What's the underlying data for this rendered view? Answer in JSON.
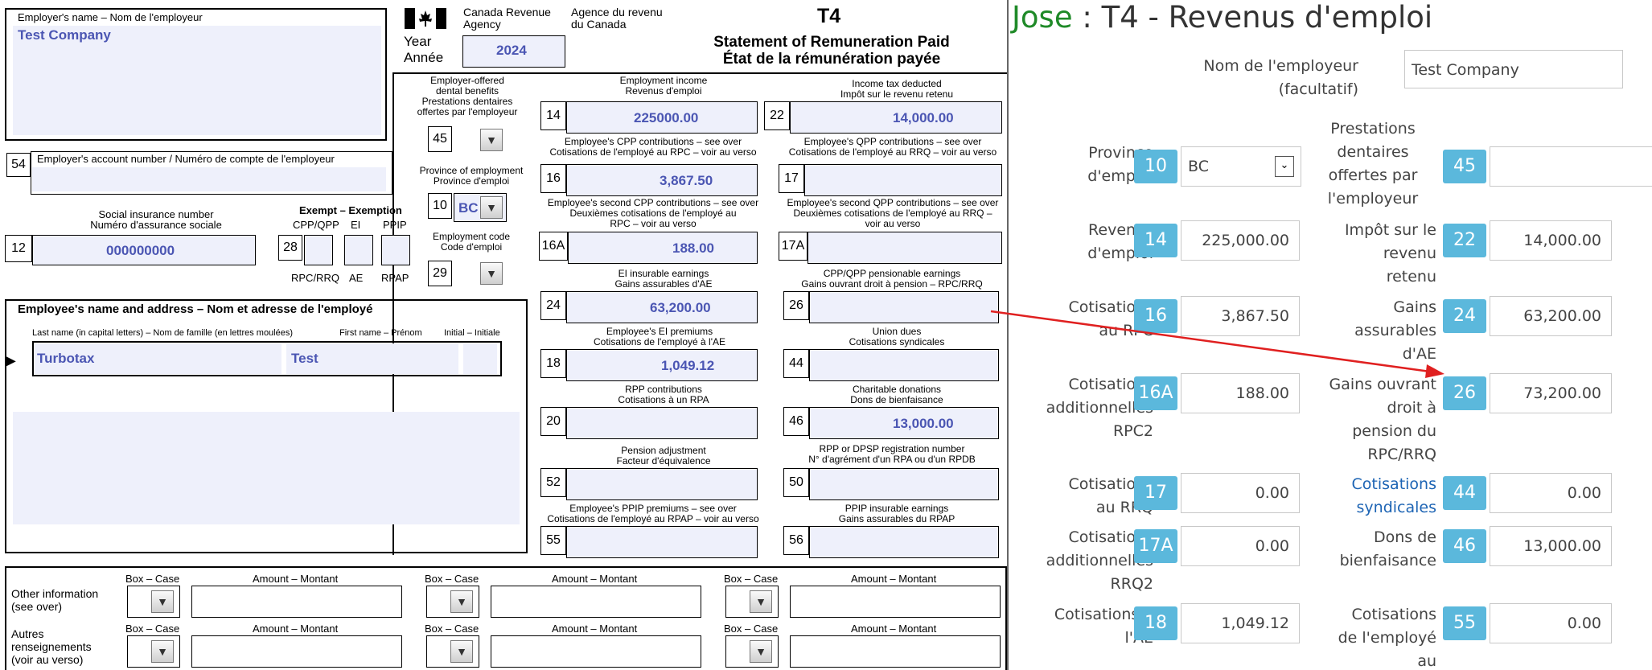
{
  "form": {
    "employer_name_label": "Employer's name – Nom de l'employeur",
    "employer_name_value": "Test Company",
    "cra_en": "Canada Revenue\nAgency",
    "cra_fr": "Agence du revenu\ndu Canada",
    "year_label": "Year\nAnnée",
    "year_value": "2024",
    "t4": "T4",
    "statement_en": "Statement of Remuneration Paid",
    "statement_fr": "État de la rémunération payée",
    "dental_label": "Employer-offered\ndental benefits\nPrestations dentaires\noffertes par l'employeur",
    "box45": "45",
    "employment_income_label": "Employment income\nRevenus d'emploi",
    "box14": "14",
    "box14_value": "225000.00",
    "tax_deducted_label": "Income tax deducted\nImpôt sur le revenu retenu",
    "box22": "22",
    "box22_value": "14,000.00",
    "account_label": "Employer's account number / Numéro de compte de l'employeur",
    "box54": "54",
    "cpp_label": "Employee's CPP contributions – see over\nCotisations de l'employé au RPC – voir au verso",
    "box16": "16",
    "box16_value": "3,867.50",
    "qpp_label": "Employee's QPP contributions – see over\nCotisations de l'employé au RRQ – voir au verso",
    "box17": "17",
    "province_label": "Province of employment\nProvince d'emploi",
    "box10": "10",
    "box10_value": "BC",
    "sin_label": "Social insurance number\nNuméro d'assurance sociale",
    "box12": "12",
    "sin_value": "000000000",
    "exempt_label": "Exempt – Exemption",
    "cpp_qpp": "CPP/QPP",
    "ei": "EI",
    "ppip": "PPIP",
    "box28": "28",
    "rpc_rrq": "RPC/RRQ",
    "ae": "AE",
    "rpap": "RPAP",
    "cpp2_label": "Employee's second CPP contributions – see over\nDeuxièmes cotisations de l'employé au\nRPC – voir au verso",
    "box16a": "16A",
    "box16a_value": "188.00",
    "qpp2_label": "Employee's second QPP contributions – see over\nDeuxièmes cotisations de l'employé au RRQ –\nvoir au verso",
    "box17a": "17A",
    "emp_code_label": "Employment code\nCode d'emploi",
    "box29": "29",
    "ei_earn_label": "EI insurable earnings\nGains assurables d'AE",
    "box24": "24",
    "box24_value": "63,200.00",
    "pens_earn_label": "CPP/QPP pensionable earnings\nGains ouvrant droit à pension – RPC/RRQ",
    "box26": "26",
    "emp_name_label": "Employee's name and address – Nom et adresse de l'employé",
    "last_name_label": "Last name (in capital letters) – Nom de famille (en lettres moulées)",
    "first_name_label": "First name – Prénom",
    "initial_label": "Initial – Initiale",
    "last_name_value": "Turbotax",
    "first_name_value": "Test",
    "ei_prem_label": "Employee's EI premiums\nCotisations de l'employé à l'AE",
    "box18": "18",
    "box18_value": "1,049.12",
    "union_label": "Union dues\nCotisations syndicales",
    "box44": "44",
    "rpp_label": "RPP contributions\nCotisations à un RPA",
    "box20": "20",
    "charity_label": "Charitable donations\nDons de bienfaisance",
    "box46": "46",
    "box46_value": "13,000.00",
    "pension_adj_label": "Pension adjustment\nFacteur d'équivalence",
    "box52": "52",
    "rpp_reg_label": "RPP or DPSP registration number\nN° d'agrément d'un RPA ou d'un RPDB",
    "box50": "50",
    "ppip_prem_label": "Employee's PPIP premiums – see over\nCotisations de l'employé au RPAP – voir au verso",
    "box55": "55",
    "ppip_earn_label": "PPIP insurable earnings\nGains assurables du RPAP",
    "box56": "56",
    "other_info_en": "Other information\n(see over)",
    "other_info_fr": "Autres\nrenseignements\n(voir au verso)",
    "box_case": "Box – Case",
    "amount_montant": "Amount – Montant"
  },
  "panel": {
    "who": "Jose",
    "sep": " : ",
    "title": "T4 - Revenus d'emploi",
    "employer_label": "Nom de l'employeur (facultatif)",
    "employer_value": "Test Company",
    "rows": {
      "province_label": "Province\nd'emploi",
      "box10": "10",
      "province_value": "BC",
      "dental_label": "Prestations\ndentaires\noffertes par\nl'employeur",
      "box45": "45",
      "income_label": "Revenus\nd'emploi",
      "box14": "14",
      "income_value": "225,000.00",
      "tax_label": "Impôt sur le\nrevenu\nretenu",
      "box22": "22",
      "tax_value": "14,000.00",
      "cpp_label": "Cotisations\nau RPC",
      "box16": "16",
      "cpp_value": "3,867.50",
      "ei_earn_label": "Gains\nassurables\nd'AE",
      "box24": "24",
      "ei_earn_value": "63,200.00",
      "cpp2_label": "Cotisations\nadditionnelles\nRPC2",
      "box16a": "16A",
      "cpp2_value": "188.00",
      "pens_label": "Gains ouvrant\ndroit à\npension du\nRPC/RRQ",
      "box26": "26",
      "pens_value": "73,200.00",
      "qpp_label": "Cotisations\nau RRQ",
      "box17": "17",
      "qpp_value": "0.00",
      "union_label": "Cotisations\nsyndicales",
      "box44": "44",
      "union_value": "0.00",
      "qpp2_label": "Cotisations\nadditionnelles\nRRQ2",
      "box17a": "17A",
      "qpp2_value": "0.00",
      "charity_label": "Dons de\nbienfaisance",
      "box46": "46",
      "charity_value": "13,000.00",
      "ei_prem_label": "Cotisations à\nl'AE",
      "box18": "18",
      "ei_prem_value": "1,049.12",
      "ppip_label": "Cotisations\nde l'employé\nau",
      "box55": "55",
      "ppip_value": "0.00"
    }
  },
  "colors": {
    "accent": "#5bb8dc",
    "arrow": "#e02020",
    "field": "#eef0fb",
    "value": "#4b56b3",
    "who": "#1f8a28"
  }
}
